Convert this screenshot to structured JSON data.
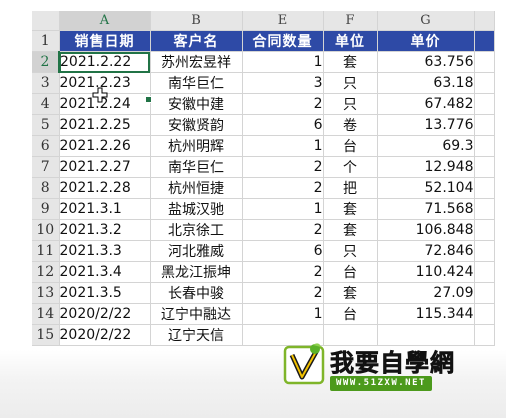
{
  "columns": [
    "A",
    "B",
    "E",
    "F",
    "G",
    ""
  ],
  "header_row": {
    "number": "1",
    "cells": [
      "销售日期",
      "客户名",
      "合同数量",
      "单位",
      "单价"
    ]
  },
  "rows": [
    {
      "num": "2",
      "date": "2021.2.22",
      "customer": "苏州宏昱祥",
      "qty": "1",
      "unit": "套",
      "price": "63.756"
    },
    {
      "num": "3",
      "date": "2021.2.23",
      "customer": "南华巨仁",
      "qty": "3",
      "unit": "只",
      "price": "63.18"
    },
    {
      "num": "4",
      "date": "2021.2.24",
      "customer": "安徽中建",
      "qty": "2",
      "unit": "只",
      "price": "67.482"
    },
    {
      "num": "5",
      "date": "2021.2.25",
      "customer": "安徽贤韵",
      "qty": "6",
      "unit": "卷",
      "price": "13.776"
    },
    {
      "num": "6",
      "date": "2021.2.26",
      "customer": "杭州明辉",
      "qty": "1",
      "unit": "台",
      "price": "69.3"
    },
    {
      "num": "7",
      "date": "2021.2.27",
      "customer": "南华巨仁",
      "qty": "2",
      "unit": "个",
      "price": "12.948"
    },
    {
      "num": "8",
      "date": "2021.2.28",
      "customer": "杭州恒捷",
      "qty": "2",
      "unit": "把",
      "price": "52.104"
    },
    {
      "num": "9",
      "date": "2021.3.1",
      "customer": "盐城汉驰",
      "qty": "1",
      "unit": "套",
      "price": "71.568"
    },
    {
      "num": "10",
      "date": "2021.3.2",
      "customer": "北京徐工",
      "qty": "2",
      "unit": "套",
      "price": "106.848"
    },
    {
      "num": "11",
      "date": "2021.3.3",
      "customer": "河北雅威",
      "qty": "6",
      "unit": "只",
      "price": "72.846"
    },
    {
      "num": "12",
      "date": "2021.3.4",
      "customer": "黑龙江振坤",
      "qty": "2",
      "unit": "台",
      "price": "110.424"
    },
    {
      "num": "13",
      "date": "2021.3.5",
      "customer": "长春中骏",
      "qty": "2",
      "unit": "套",
      "price": "27.09"
    },
    {
      "num": "14",
      "date": "2020/2/22",
      "customer": "辽宁中融达",
      "qty": "1",
      "unit": "台",
      "price": "115.344"
    },
    {
      "num": "15",
      "date": "2020/2/22",
      "customer": "辽宁天信",
      "qty": "",
      "unit": "",
      "price": ""
    }
  ],
  "active_cell": "A2",
  "watermark": {
    "title": "我要自學網",
    "url": "WWW.51ZXW.NET"
  },
  "colors": {
    "header_fill": "#2e4aa6",
    "selection": "#217346",
    "band_line": "#3a5aaa"
  }
}
